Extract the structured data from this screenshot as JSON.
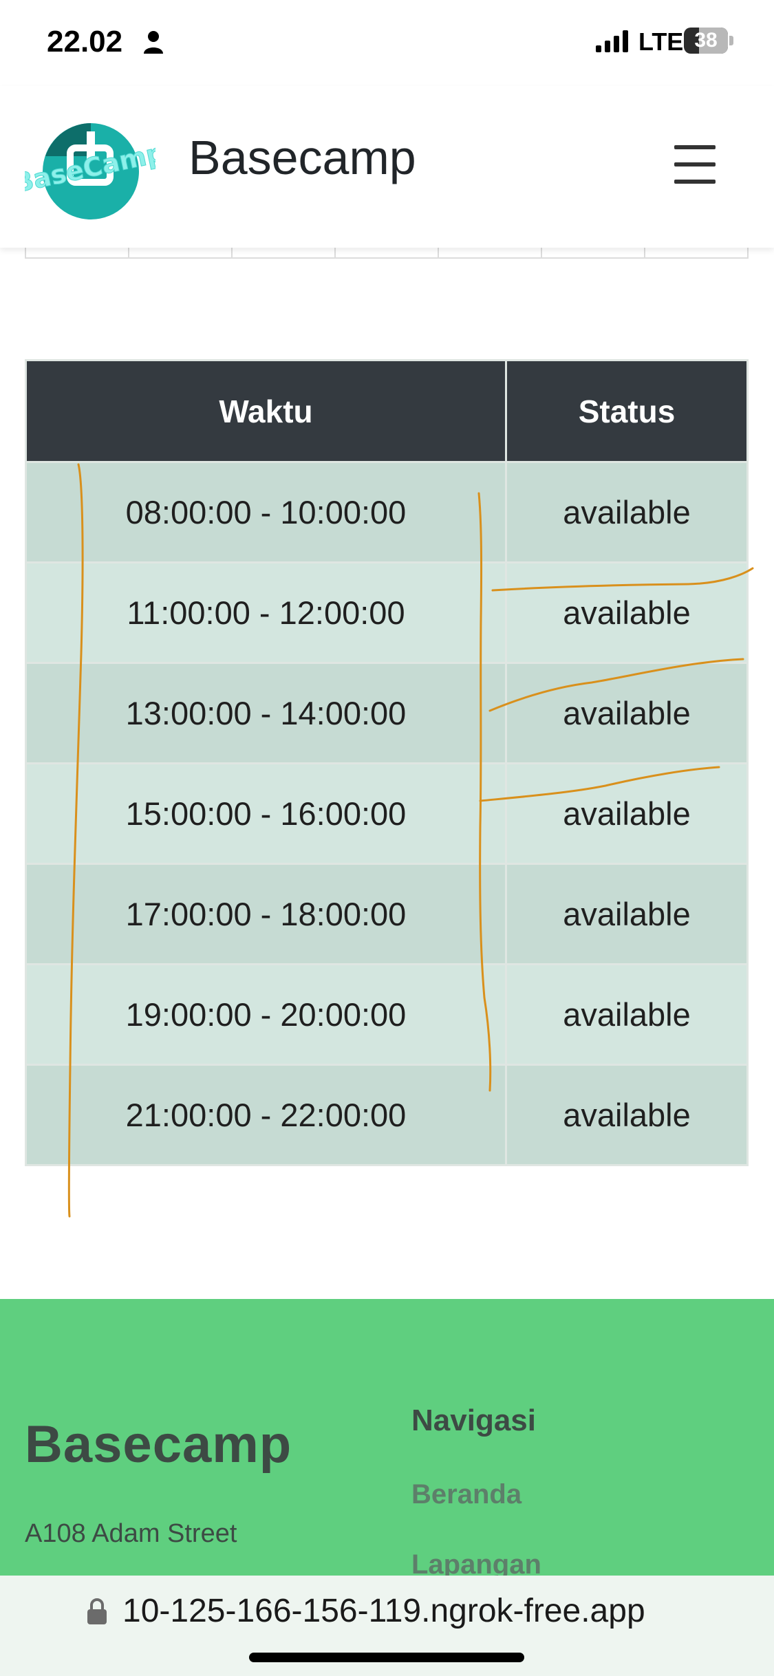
{
  "status_bar": {
    "time": "22.02",
    "network": "LTE",
    "battery": "38",
    "icons": [
      "person-icon",
      "signal-icon",
      "battery-icon"
    ]
  },
  "navbar": {
    "brand": "Basecamp",
    "logo_text": "BaseCamp",
    "icons": [
      "basecamp-logo",
      "hamburger-menu-icon"
    ]
  },
  "schedule": {
    "headers": {
      "time": "Waktu",
      "status": "Status"
    },
    "rows": [
      {
        "time": "08:00:00 - 10:00:00",
        "status": "available"
      },
      {
        "time": "11:00:00 - 12:00:00",
        "status": "available"
      },
      {
        "time": "13:00:00 - 14:00:00",
        "status": "available"
      },
      {
        "time": "15:00:00 - 16:00:00",
        "status": "available"
      },
      {
        "time": "17:00:00 - 18:00:00",
        "status": "available"
      },
      {
        "time": "19:00:00 - 20:00:00",
        "status": "available"
      },
      {
        "time": "21:00:00 - 22:00:00",
        "status": "available"
      }
    ]
  },
  "footer": {
    "brand": "Basecamp",
    "address": "A108 Adam Street",
    "nav_title": "Navigasi",
    "nav_links": [
      "Beranda",
      "Lapangan"
    ]
  },
  "browser": {
    "url": "10-125-166-156-119.ngrok-free.app",
    "icons": [
      "lock-icon"
    ]
  },
  "colors": {
    "table_header": "#343a40",
    "row_odd": "#c6dbd3",
    "row_even": "#d3e6df",
    "footer_bg": "#5fcf7f",
    "annotation_stroke": "#d9901c",
    "logo_teal": "#1ab0a8"
  }
}
